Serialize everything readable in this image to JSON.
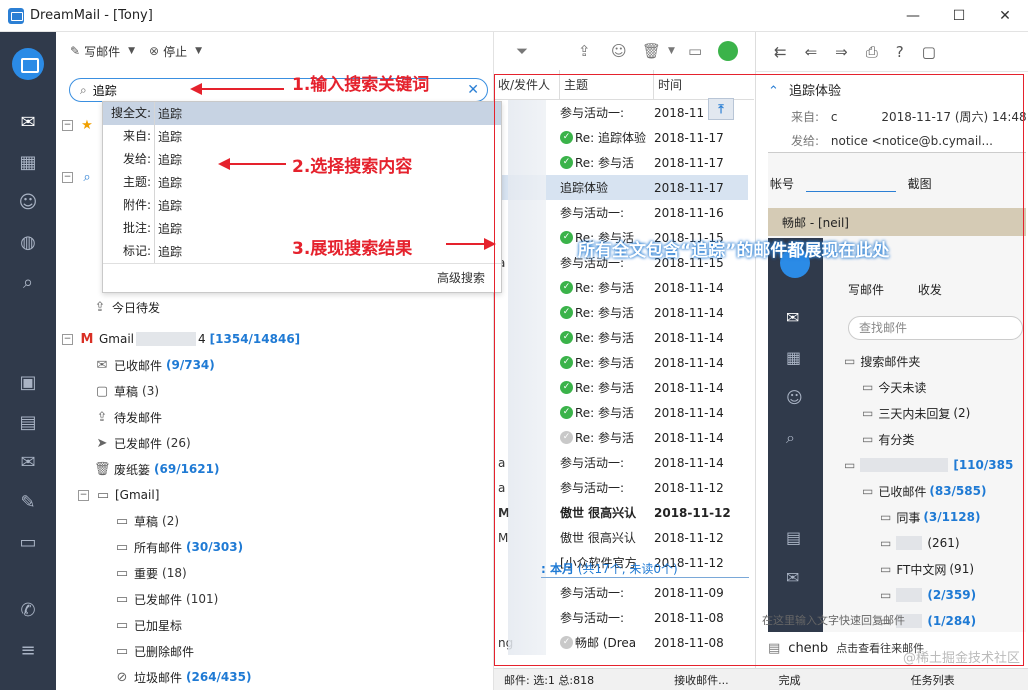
{
  "window": {
    "title": "DreamMail - [Tony]"
  },
  "toolbar": {
    "compose": "写邮件",
    "stop": "停止"
  },
  "search": {
    "value": "追踪"
  },
  "dropdown": {
    "items": [
      {
        "label": "搜全文:",
        "value": "追踪"
      },
      {
        "label": "来自:",
        "value": "追踪"
      },
      {
        "label": "发给:",
        "value": "追踪"
      },
      {
        "label": "主题:",
        "value": "追踪"
      },
      {
        "label": "附件:",
        "value": "追踪"
      },
      {
        "label": "批注:",
        "value": "追踪"
      },
      {
        "label": "标记:",
        "value": "追踪"
      }
    ],
    "advanced": "高级搜索"
  },
  "tree": {
    "today": "今日待发",
    "account": {
      "name": "Gmail",
      "suffix": "4",
      "count": "[1354/14846]"
    },
    "folders": [
      {
        "name": "已收邮件",
        "count": "(9/734)",
        "hl": true
      },
      {
        "name": "草稿",
        "count": "(3)",
        "hl": false
      },
      {
        "name": "待发邮件",
        "count": "",
        "hl": false
      },
      {
        "name": "已发邮件",
        "count": "(26)",
        "hl": false
      },
      {
        "name": "废纸篓",
        "count": "(69/1621)",
        "hl": true
      }
    ],
    "gmail_group": "[Gmail]",
    "gmail_folders": [
      {
        "name": "草稿",
        "count": "(2)",
        "hl": false
      },
      {
        "name": "所有邮件",
        "count": "(30/303)",
        "hl": true
      },
      {
        "name": "重要",
        "count": "(18)",
        "hl": false
      },
      {
        "name": "已发邮件",
        "count": "(101)",
        "hl": false
      },
      {
        "name": "已加星标",
        "count": "",
        "hl": false
      },
      {
        "name": "已删除邮件",
        "count": "",
        "hl": false
      },
      {
        "name": "垃圾邮件",
        "count": "(264/435)",
        "hl": true
      }
    ]
  },
  "list": {
    "columns": {
      "sender": "收/发件人",
      "subject": "主题",
      "time": "时间"
    },
    "rows": [
      {
        "sender": "",
        "subject": "参与活动一:",
        "time": "2018-11",
        "icon": "none",
        "sel": false,
        "bold": false
      },
      {
        "sender": "",
        "subject": "Re: 追踪体验",
        "time": "2018-11-17",
        "icon": "check",
        "sel": false,
        "bold": false
      },
      {
        "sender": "",
        "subject": "Re: 参与活",
        "time": "2018-11-17",
        "icon": "check",
        "sel": false,
        "bold": false
      },
      {
        "sender": "",
        "subject": "追踪体验",
        "time": "2018-11-17",
        "icon": "none",
        "sel": true,
        "bold": false
      },
      {
        "sender": "",
        "subject": "参与活动一:",
        "time": "2018-11-16",
        "icon": "none",
        "sel": false,
        "bold": false
      },
      {
        "sender": "",
        "subject": "Re: 参与活",
        "time": "2018-11-15",
        "icon": "check",
        "sel": false,
        "bold": false
      },
      {
        "sender": "a",
        "subject": "参与活动一:",
        "time": "2018-11-15",
        "icon": "none",
        "sel": false,
        "bold": false
      },
      {
        "sender": "",
        "subject": "Re: 参与活",
        "time": "2018-11-14",
        "icon": "check",
        "sel": false,
        "bold": false
      },
      {
        "sender": "",
        "subject": "Re: 参与活",
        "time": "2018-11-14",
        "icon": "check",
        "sel": false,
        "bold": false
      },
      {
        "sender": "",
        "subject": "Re: 参与活",
        "time": "2018-11-14",
        "icon": "check",
        "sel": false,
        "bold": false
      },
      {
        "sender": "",
        "subject": "Re: 参与活",
        "time": "2018-11-14",
        "icon": "check",
        "sel": false,
        "bold": false
      },
      {
        "sender": "",
        "subject": "Re: 参与活",
        "time": "2018-11-14",
        "icon": "check",
        "sel": false,
        "bold": false
      },
      {
        "sender": "",
        "subject": "Re: 参与活",
        "time": "2018-11-14",
        "icon": "check",
        "sel": false,
        "bold": false
      },
      {
        "sender": "",
        "subject": "Re: 参与活",
        "time": "2018-11-14",
        "icon": "grey",
        "sel": false,
        "bold": false
      },
      {
        "sender": "a",
        "subject": "参与活动一:",
        "time": "2018-11-14",
        "icon": "none",
        "sel": false,
        "bold": false
      },
      {
        "sender": "a",
        "subject": "参与活动一:",
        "time": "2018-11-12",
        "icon": "none",
        "sel": false,
        "bold": false
      },
      {
        "sender": "M",
        "subject": "傲世 很高兴认",
        "time": "2018-11-12",
        "icon": "none",
        "sel": false,
        "bold": true
      },
      {
        "sender": "M",
        "subject": "傲世 很高兴认",
        "time": "2018-11-12",
        "icon": "none",
        "sel": false,
        "bold": false
      },
      {
        "sender": "",
        "subject": "[小众软件官方",
        "time": "2018-11-12",
        "icon": "none",
        "sel": false,
        "bold": false
      }
    ],
    "group_label": ": 本月",
    "group_count": "(共17个, 未读0个)",
    "rows2": [
      {
        "sender": "",
        "subject": "参与活动一:",
        "time": "2018-11-09",
        "icon": "none"
      },
      {
        "sender": "",
        "subject": "参与活动一:",
        "time": "2018-11-08",
        "icon": "none"
      },
      {
        "sender": "ng",
        "subject": "畅邮 (Drea",
        "time": "2018-11-08",
        "icon": "grey"
      }
    ]
  },
  "reader": {
    "subject": "追踪体验",
    "from_label": "来自:",
    "from": "c",
    "date": "2018-11-17 (周六) 14:48",
    "to_label": "发给:",
    "to": "notice <notice@b.cymail...",
    "account_label": "帐号",
    "screenshot_label": "截图",
    "inner_header": "畅邮 - [neil]",
    "inner_compose": "写邮件",
    "inner_receive": "收发",
    "inner_search": "查找邮件",
    "inner_rows": [
      {
        "name": "搜索邮件夹",
        "count": "",
        "hl": false
      },
      {
        "name": "今天未读",
        "count": "",
        "hl": false
      },
      {
        "name": "三天内未回复",
        "count": "(2)",
        "hl": false
      },
      {
        "name": "有分类",
        "count": "",
        "hl": false
      },
      {
        "name": "",
        "count": "[110/385",
        "hl": true
      },
      {
        "name": "已收邮件",
        "count": "(83/585)",
        "hl": true
      },
      {
        "name": "同事",
        "count": "(3/1128)",
        "hl": true
      },
      {
        "name": "",
        "count": "(261)",
        "hl": false
      },
      {
        "name": "FT中文网",
        "count": "(91)",
        "hl": false
      },
      {
        "name": "",
        "count": "(2/359)",
        "hl": true
      },
      {
        "name": "",
        "count": "(1/284)",
        "hl": true
      }
    ],
    "quick_reply": "在这里输入文字快速回复邮件",
    "footer_name": "chenb",
    "footer_text": "点击查看往来邮件"
  },
  "status": {
    "mail": "邮件: 选:1 总:818",
    "receiving": "接收邮件...",
    "done": "完成",
    "tasks": "任务列表"
  },
  "annotations": {
    "step1": "1.输入搜索关键词",
    "step2": "2.选择搜索内容",
    "step3": "3.展现搜索结果",
    "result": "所有全文包含“追踪”的邮件都展现在此处",
    "watermark": "@稀土掘金技术社区"
  }
}
